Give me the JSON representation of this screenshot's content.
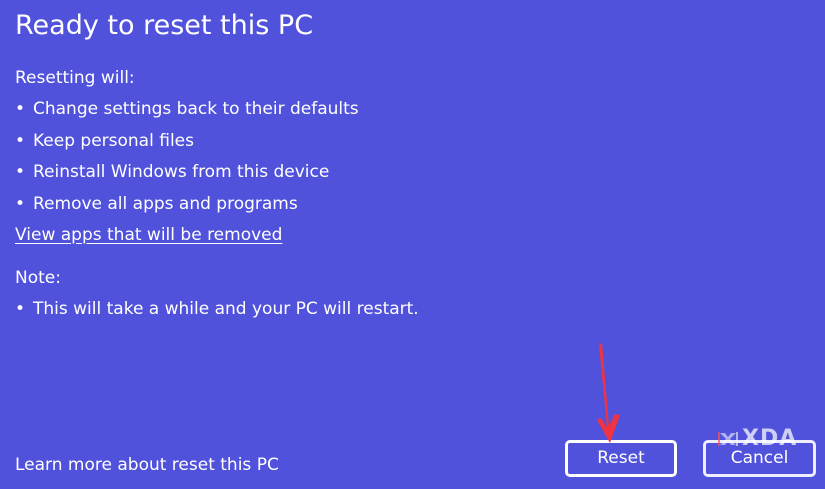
{
  "dialog": {
    "title": "Ready to reset this PC",
    "resetting_label": "Resetting will:",
    "resetting_items": [
      "Change settings back to their defaults",
      "Keep personal files",
      "Reinstall Windows from this device",
      "Remove all apps and programs"
    ],
    "view_apps_link": "View apps that will be removed",
    "note_label": "Note:",
    "note_items": [
      "This will take a while and your PC will restart."
    ],
    "learn_more_link": "Learn more about reset this PC"
  },
  "buttons": {
    "reset_label": "Reset",
    "cancel_label": "Cancel"
  },
  "overlay": {
    "watermark_text": "XDA",
    "arrow_color": "#ef3340",
    "bullet_symbol": "•"
  },
  "theme": {
    "background": "#5152dc",
    "text": "#ffffff"
  }
}
